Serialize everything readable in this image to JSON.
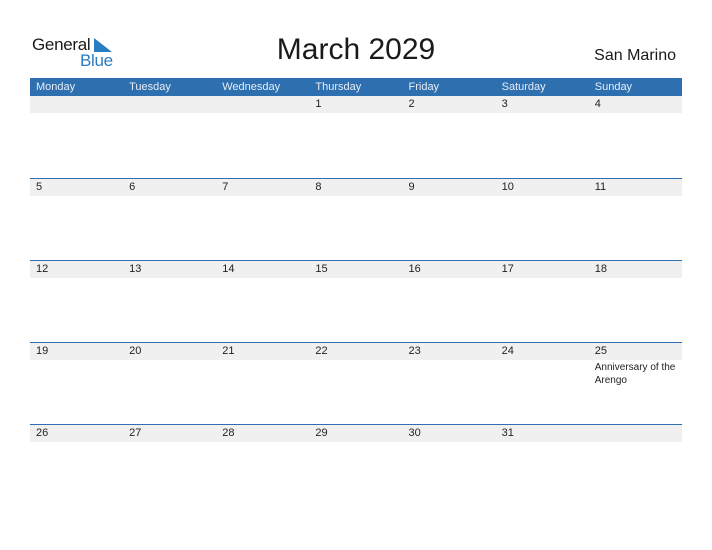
{
  "logo": {
    "line1": "General",
    "line2": "Blue"
  },
  "header": {
    "title": "March 2029",
    "country": "San Marino"
  },
  "weekdays": [
    "Monday",
    "Tuesday",
    "Wednesday",
    "Thursday",
    "Friday",
    "Saturday",
    "Sunday"
  ],
  "weeks": [
    {
      "days": [
        "",
        "",
        "",
        "1",
        "2",
        "3",
        "4"
      ],
      "events": [
        "",
        "",
        "",
        "",
        "",
        "",
        ""
      ]
    },
    {
      "days": [
        "5",
        "6",
        "7",
        "8",
        "9",
        "10",
        "11"
      ],
      "events": [
        "",
        "",
        "",
        "",
        "",
        "",
        ""
      ]
    },
    {
      "days": [
        "12",
        "13",
        "14",
        "15",
        "16",
        "17",
        "18"
      ],
      "events": [
        "",
        "",
        "",
        "",
        "",
        "",
        ""
      ]
    },
    {
      "days": [
        "19",
        "20",
        "21",
        "22",
        "23",
        "24",
        "25"
      ],
      "events": [
        "",
        "",
        "",
        "",
        "",
        "",
        "Anniversary of the Arengo"
      ]
    },
    {
      "days": [
        "26",
        "27",
        "28",
        "29",
        "30",
        "31",
        ""
      ],
      "events": [
        "",
        "",
        "",
        "",
        "",
        "",
        ""
      ]
    }
  ],
  "colors": {
    "accent": "#2e6faf",
    "logo_blue": "#2b7bc0",
    "date_row_bg": "#f0f0f0"
  }
}
